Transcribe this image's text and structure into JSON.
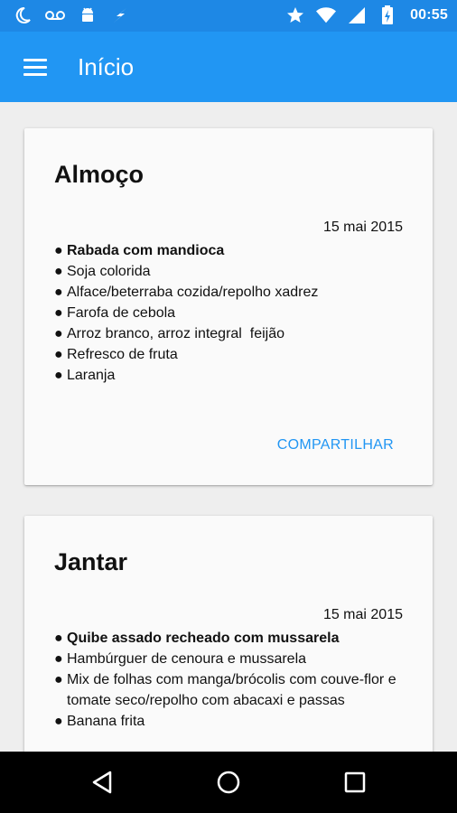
{
  "status_bar": {
    "time": "00:55",
    "icons": [
      "moon-icon",
      "voicemail-icon",
      "android-icon",
      "flash-icon",
      "star-icon",
      "wifi-icon",
      "signal-icon",
      "battery-charging-icon"
    ]
  },
  "app_bar": {
    "title": "Início",
    "menu_icon": "hamburger-menu-icon"
  },
  "cards": [
    {
      "title": "Almoço",
      "date": "15 mai 2015",
      "items": [
        "Rabada com mandioca",
        "Soja colorida",
        "Alface/beterraba cozida/repolho xadrez",
        "Farofa de cebola",
        "Arroz branco, arroz integral  feijão",
        "Refresco de fruta",
        "Laranja"
      ],
      "share_label": "COMPARTILHAR"
    },
    {
      "title": "Jantar",
      "date": "15 mai 2015",
      "items": [
        "Quibe assado recheado com mussarela",
        "Hambúrguer de cenoura e mussarela",
        "Mix de folhas com manga/brócolis com couve-flor e tomate seco/repolho com abacaxi e passas",
        "Banana frita"
      ]
    }
  ],
  "bullet": "●",
  "colors": {
    "status_bar": "#1e88e5",
    "app_bar": "#2196f3",
    "accent": "#2196f3",
    "background": "#eeeeee",
    "card": "#fafafa"
  },
  "nav_bar": {
    "icons": [
      "back-icon",
      "home-icon",
      "recent-apps-icon"
    ]
  }
}
